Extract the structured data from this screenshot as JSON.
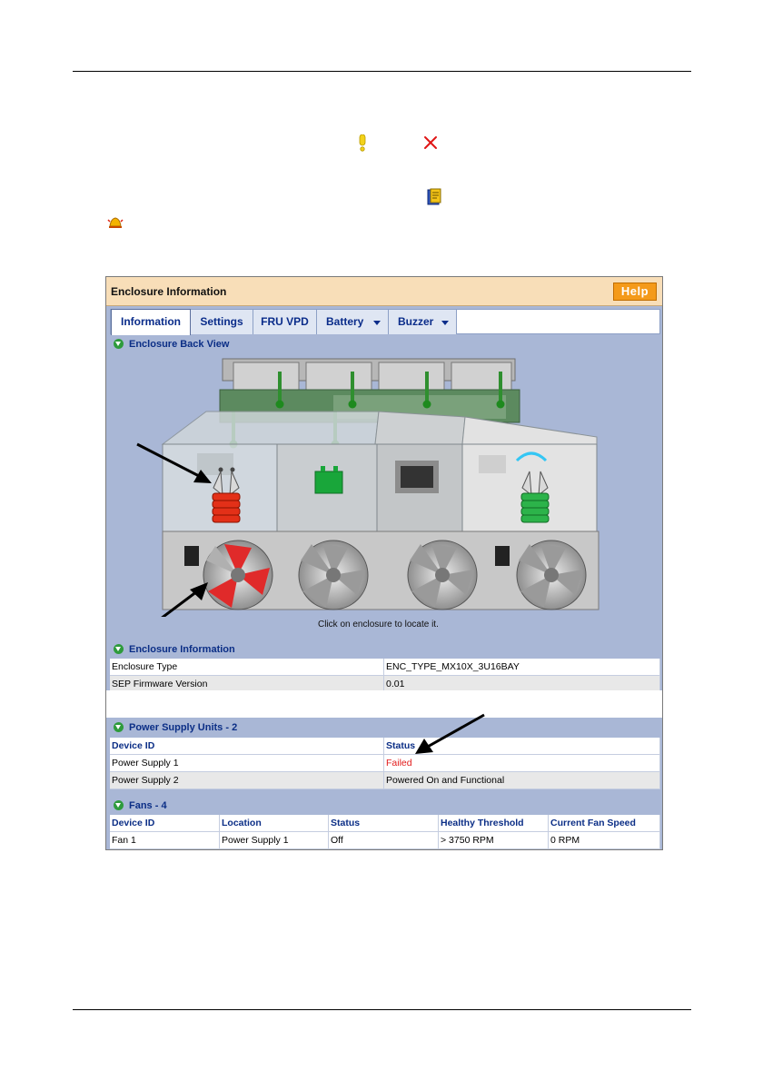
{
  "panel": {
    "title": "Enclosure Information",
    "help_label": "Help",
    "tabs": [
      {
        "label": "Information",
        "active": true
      },
      {
        "label": "Settings"
      },
      {
        "label": "FRU VPD"
      },
      {
        "label": "Battery",
        "dropdown": true
      },
      {
        "label": "Buzzer",
        "dropdown": true
      }
    ],
    "back_view_title": "Enclosure Back View",
    "locate_hint": "Click on enclosure to locate it."
  },
  "enclosure_info": {
    "title": "Enclosure Information",
    "rows": [
      {
        "label": "Enclosure Type",
        "value": "ENC_TYPE_MX10X_3U16BAY"
      },
      {
        "label": "SEP Firmware Version",
        "value": "0.01"
      }
    ]
  },
  "psu": {
    "title": "Power Supply Units - 2",
    "headers": [
      "Device ID",
      "Status"
    ],
    "rows": [
      {
        "device": "Power Supply 1",
        "status": "Failed",
        "failed": true
      },
      {
        "device": "Power Supply 2",
        "status": "Powered On and Functional"
      }
    ]
  },
  "fans": {
    "title": "Fans - 4",
    "headers": [
      "Device ID",
      "Location",
      "Status",
      "Healthy Threshold",
      "Current Fan Speed"
    ],
    "rows": [
      {
        "device": "Fan 1",
        "location": "Power Supply 1",
        "status": "Off",
        "threshold": "> 3750 RPM",
        "speed": "0 RPM"
      }
    ]
  },
  "icons": {
    "warning": "exclamation-icon",
    "error": "red-x-icon",
    "book": "book-icon",
    "alarm": "alarm-bell-icon"
  },
  "colors": {
    "failed": "#e21b1b",
    "ok": "#2e9b3c",
    "help": "#f49a1a"
  }
}
